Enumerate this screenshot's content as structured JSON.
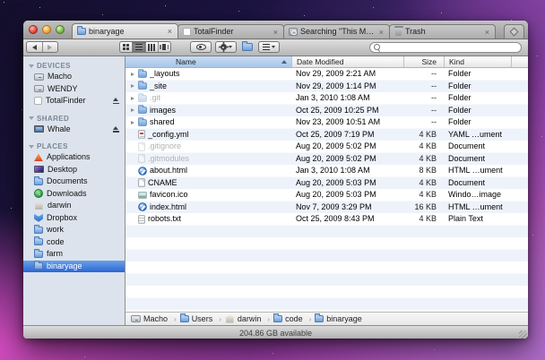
{
  "tabs": [
    {
      "label": "binaryage",
      "icon": "folder",
      "active": true,
      "close": "×"
    },
    {
      "label": "TotalFinder",
      "icon": "whitedisk",
      "close": "×"
    },
    {
      "label": "Searching \"This Mac\"",
      "icon": "searchfolder",
      "close": "×"
    },
    {
      "label": "Trash",
      "icon": "trash",
      "close": "×"
    }
  ],
  "toolbar": {
    "search_placeholder": "",
    "buttons": [
      "back",
      "forward",
      "icon-view",
      "list-view",
      "column-view",
      "coverflow-view",
      "quick-look",
      "action-menu",
      "new-folder",
      "arrange-menu",
      "search"
    ]
  },
  "sidebar": {
    "sections": [
      {
        "label": "DEVICES"
      },
      {
        "label": "SHARED"
      },
      {
        "label": "PLACES"
      }
    ],
    "devices": [
      {
        "name": "Macho",
        "icon": "disk"
      },
      {
        "name": "WENDY",
        "icon": "disk"
      },
      {
        "name": "TotalFinder",
        "icon": "whitedisk",
        "eject": true
      }
    ],
    "shared": [
      {
        "name": "Whale",
        "icon": "display",
        "eject": true
      }
    ],
    "places": [
      {
        "name": "Applications",
        "icon": "apps"
      },
      {
        "name": "Desktop",
        "icon": "desktop"
      },
      {
        "name": "Documents",
        "icon": "folder"
      },
      {
        "name": "Downloads",
        "icon": "downloads"
      },
      {
        "name": "darwin",
        "icon": "home"
      },
      {
        "name": "Dropbox",
        "icon": "dropbox"
      },
      {
        "name": "work",
        "icon": "folder"
      },
      {
        "name": "code",
        "icon": "folder"
      },
      {
        "name": "farm",
        "icon": "folder"
      },
      {
        "name": "binaryage",
        "icon": "folder",
        "selected": true
      }
    ]
  },
  "list": {
    "columns": [
      "Name",
      "Date Modified",
      "Size",
      "Kind"
    ],
    "sort_column": "Name",
    "sort_direction": "ascending",
    "rows": [
      {
        "name": "_layouts",
        "icon": "folder",
        "expandable": true,
        "date": "Nov 29, 2009 2:21 AM",
        "size": "--",
        "kind": "Folder"
      },
      {
        "name": "_site",
        "icon": "folder",
        "expandable": true,
        "date": "Nov 29, 2009 1:14 PM",
        "size": "--",
        "kind": "Folder"
      },
      {
        "name": ".git",
        "icon": "folder",
        "expandable": true,
        "dimmed": true,
        "date": "Jan 3, 2010 1:08 AM",
        "size": "--",
        "kind": "Folder"
      },
      {
        "name": "images",
        "icon": "folder",
        "expandable": true,
        "date": "Oct 25, 2009 10:25 PM",
        "size": "--",
        "kind": "Folder"
      },
      {
        "name": "shared",
        "icon": "folder",
        "expandable": true,
        "date": "Nov 23, 2009 10:51 AM",
        "size": "--",
        "kind": "Folder"
      },
      {
        "name": "_config.yml",
        "icon": "yaml",
        "date": "Oct 25, 2009 7:19 PM",
        "size": "4 KB",
        "kind": "YAML …ument"
      },
      {
        "name": ".gitignore",
        "icon": "doc",
        "dimmed": true,
        "date": "Aug 20, 2009 5:02 PM",
        "size": "4 KB",
        "kind": "Document"
      },
      {
        "name": ".gitmodules",
        "icon": "doc",
        "dimmed": true,
        "date": "Aug 20, 2009 5:02 PM",
        "size": "4 KB",
        "kind": "Document"
      },
      {
        "name": "about.html",
        "icon": "html",
        "date": "Jan 3, 2010 1:08 AM",
        "size": "8 KB",
        "kind": "HTML …ument"
      },
      {
        "name": "CNAME",
        "icon": "doc",
        "date": "Aug 20, 2009 5:03 PM",
        "size": "4 KB",
        "kind": "Document"
      },
      {
        "name": "favicon.ico",
        "icon": "image",
        "date": "Aug 20, 2009 5:03 PM",
        "size": "4 KB",
        "kind": "Windo…image"
      },
      {
        "name": "index.html",
        "icon": "html",
        "date": "Nov 7, 2009 3:29 PM",
        "size": "16 KB",
        "kind": "HTML …ument"
      },
      {
        "name": "robots.txt",
        "icon": "text",
        "date": "Oct 25, 2009 8:43 PM",
        "size": "4 KB",
        "kind": "Plain Text"
      }
    ]
  },
  "pathbar": {
    "items": [
      {
        "name": "Macho",
        "icon": "disk",
        "sep": "›"
      },
      {
        "name": "Users",
        "icon": "folder",
        "sep": "›"
      },
      {
        "name": "darwin",
        "icon": "home",
        "sep": "›"
      },
      {
        "name": "code",
        "icon": "folder",
        "sep": "›"
      },
      {
        "name": "binaryage",
        "icon": "folder",
        "sep": ""
      }
    ]
  },
  "statusbar": {
    "text": "204.86 GB available"
  }
}
